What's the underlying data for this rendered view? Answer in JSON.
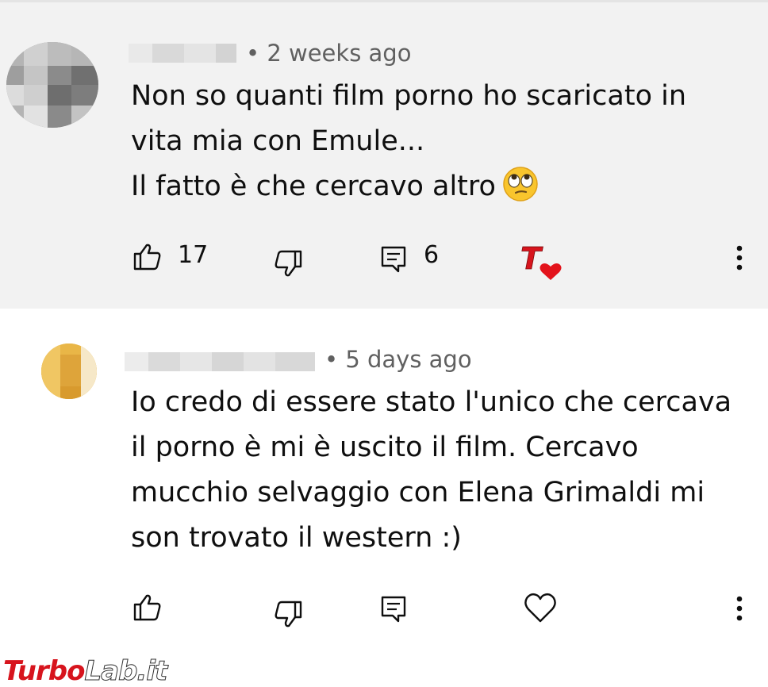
{
  "comments": [
    {
      "timestamp": "• 2 weeks ago",
      "text_lines": [
        "Non so quanti film porno ho scaricato in",
        "vita mia con Emule...",
        "Il fatto è che cercavo altro"
      ],
      "emoji": "face-with-rolling-eyes",
      "like_count": "17",
      "reply_count": "6",
      "creator_heart": "creator-heart-badge"
    },
    {
      "timestamp": "• 5 days ago",
      "text_lines": [
        "Io credo di essere stato l'unico che cercava",
        "il porno è mi è uscito il film. Cercavo",
        "mucchio selvaggio con Elena Grimaldi mi",
        "son trovato il western :)"
      ]
    }
  ],
  "watermark": {
    "part1": "Turbo",
    "part2": "Lab.it"
  },
  "colors": {
    "accent_red": "#d7141d",
    "background_highlight": "#f2f2f2",
    "meta_gray": "#606060"
  }
}
